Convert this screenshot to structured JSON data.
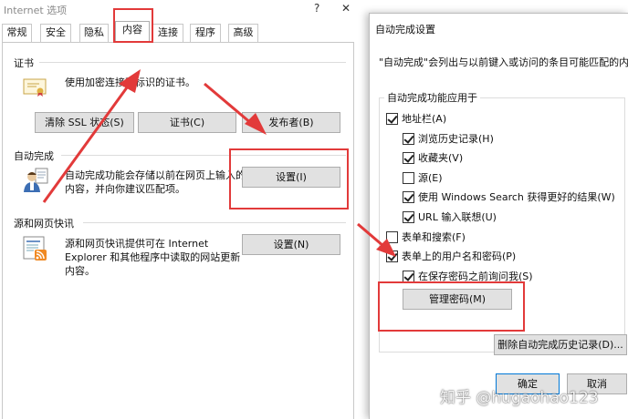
{
  "left_window": {
    "title": "Internet 选项",
    "controls": {
      "help": "?",
      "close": "✕"
    },
    "tabs": [
      {
        "label": "常规"
      },
      {
        "label": "安全"
      },
      {
        "label": "隐私"
      },
      {
        "label": "内容"
      },
      {
        "label": "连接"
      },
      {
        "label": "程序"
      },
      {
        "label": "高级"
      }
    ],
    "active_tab": "内容",
    "certificates": {
      "section_label": "证书",
      "description": "使用加密连接和标识的证书。",
      "buttons": {
        "clear_ssl": "清除 SSL 状态(S)",
        "certificates": "证书(C)",
        "publishers": "发布者(B)"
      }
    },
    "autocomplete": {
      "section_label": "自动完成",
      "description_line1": "自动完成功能会存储以前在网页上输入的",
      "description_line2": "内容，并向你建议匹配项。",
      "settings_button": "设置(I)"
    },
    "feeds": {
      "section_label": "源和网页快讯",
      "description_line1": "源和网页快讯提供可在 Internet",
      "description_line2": "Explorer 和其他程序中读取的网站更新",
      "description_line3": "内容。",
      "settings_button": "设置(N)"
    }
  },
  "right_window": {
    "title": "自动完成设置",
    "intro": "\"自动完成\"会列出与以前键入或访问的条目可能匹配的内容。",
    "group_title": "自动完成功能应用于",
    "options": [
      {
        "label": "地址栏(A)",
        "checked": true
      },
      {
        "label": "浏览历史记录(H)",
        "checked": true
      },
      {
        "label": "收藏夹(V)",
        "checked": true
      },
      {
        "label": "源(E)",
        "checked": false
      },
      {
        "label": "使用 Windows Search 获得更好的结果(W)",
        "checked": true
      },
      {
        "label": "URL 输入联想(U)",
        "checked": true
      },
      {
        "label": "表单和搜索(F)",
        "checked": false
      },
      {
        "label": "表单上的用户名和密码(P)",
        "checked": true
      },
      {
        "label": "在保存密码之前询问我(S)",
        "checked": true
      }
    ],
    "manage_passwords_button": "管理密码(M)",
    "delete_history_button": "删除自动完成历史记录(D)...",
    "ok_button": "确定",
    "cancel_button": "取消"
  },
  "watermark": "知乎 @hugaohao123",
  "colors": {
    "annotation_red": "#e23a3a",
    "button_face": "#e1e1e1"
  }
}
